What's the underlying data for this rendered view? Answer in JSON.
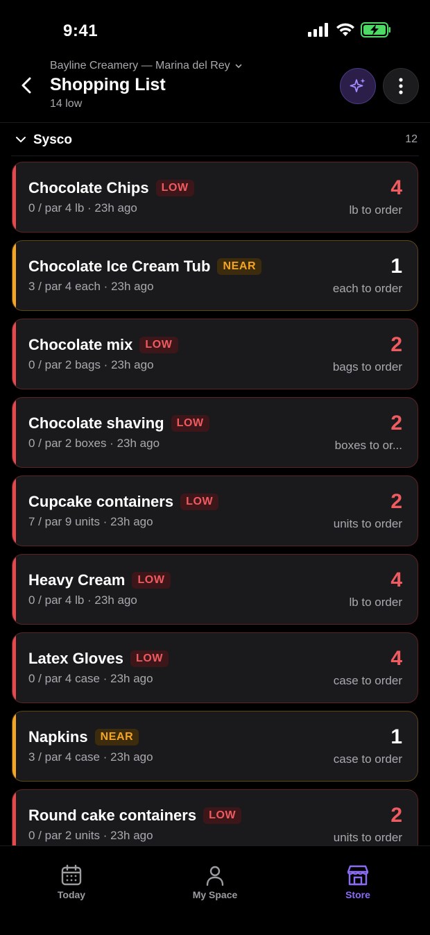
{
  "status_bar": {
    "time": "9:41"
  },
  "header": {
    "store_name": "Bayline Creamery — Marina del Rey",
    "title": "Shopping List",
    "subtitle": "14 low"
  },
  "section": {
    "title": "Sysco",
    "count": "12"
  },
  "items": [
    {
      "name": "Chocolate Chips",
      "status": "LOW",
      "meta": "0 / par 4 lb · 23h ago",
      "qty": "4",
      "unit": "lb to order"
    },
    {
      "name": "Chocolate Ice Cream Tub",
      "status": "NEAR",
      "meta": "3 / par 4 each · 23h ago",
      "qty": "1",
      "unit": "each to order"
    },
    {
      "name": "Chocolate mix",
      "status": "LOW",
      "meta": "0 / par 2 bags · 23h ago",
      "qty": "2",
      "unit": "bags to order"
    },
    {
      "name": "Chocolate shaving",
      "status": "LOW",
      "meta": "0 / par 2 boxes · 23h ago",
      "qty": "2",
      "unit": "boxes to or..."
    },
    {
      "name": "Cupcake containers",
      "status": "LOW",
      "meta": "7 / par 9 units · 23h ago",
      "qty": "2",
      "unit": "units to order"
    },
    {
      "name": "Heavy Cream",
      "status": "LOW",
      "meta": "0 / par 4 lb · 23h ago",
      "qty": "4",
      "unit": "lb to order"
    },
    {
      "name": "Latex Gloves",
      "status": "LOW",
      "meta": "0 / par 4 case · 23h ago",
      "qty": "4",
      "unit": "case to order"
    },
    {
      "name": "Napkins",
      "status": "NEAR",
      "meta": "3 / par 4 case · 23h ago",
      "qty": "1",
      "unit": "case to order"
    },
    {
      "name": "Round cake containers",
      "status": "LOW",
      "meta": "0 / par 2 units · 23h ago",
      "qty": "2",
      "unit": "units to order"
    }
  ],
  "tabs": [
    {
      "label": "Today",
      "icon": "calendar-icon"
    },
    {
      "label": "My Space",
      "icon": "person-icon"
    },
    {
      "label": "Store",
      "icon": "store-icon"
    }
  ],
  "colors": {
    "low": "#e5484d",
    "near": "#f5a524",
    "accent": "#8b6cf5"
  }
}
